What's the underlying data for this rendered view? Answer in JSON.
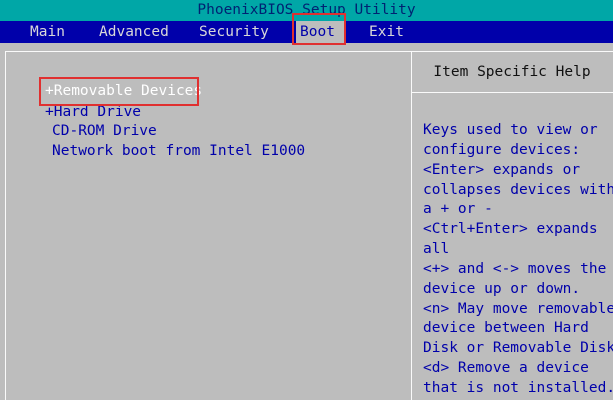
{
  "title": "PhoenixBIOS Setup Utility",
  "menu": {
    "items": [
      "Main",
      "Advanced",
      "Security",
      "Boot",
      "Exit"
    ],
    "active": "Boot"
  },
  "boot_order": [
    "+Removable Devices",
    "+Hard Drive",
    "CD-ROM Drive",
    "Network boot from Intel E1000"
  ],
  "help": {
    "header": "Item Specific Help",
    "lines": [
      "Keys used to view or",
      "configure devices:",
      "<Enter> expands or",
      "collapses devices with",
      "a + or -",
      "<Ctrl+Enter> expands",
      "all",
      "<+> and <-> moves the",
      "device up or down.",
      "<n> May move removable",
      "device between Hard",
      "Disk or Removable Disk",
      "<d> Remove a device",
      "that is not installed."
    ]
  },
  "colors": {
    "title_bg": "#00a7a7",
    "menu_bg": "#0000aa",
    "panel_bg": "#bdbdbd",
    "selected_text": "#ffffff",
    "highlight_box": "#e03030"
  }
}
